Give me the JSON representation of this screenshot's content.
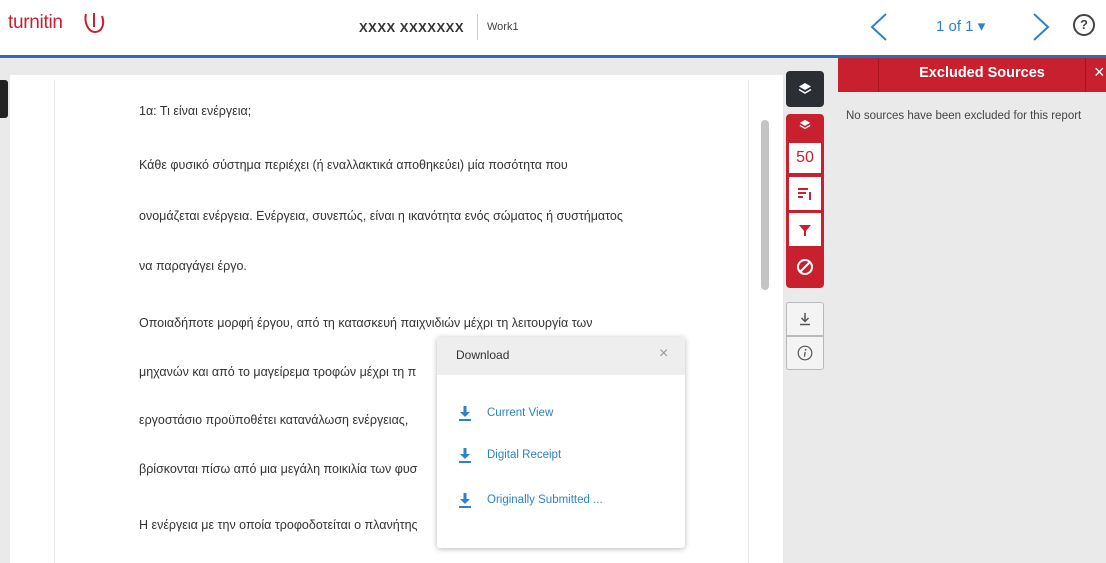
{
  "header": {
    "logo_text": "turnitin",
    "author": "XXXX XXXXXXX",
    "work_title": "Work1",
    "page_indicator": "1 of 1 ▾",
    "help_label": "?"
  },
  "document": {
    "lines": [
      "1α: Τι είναι ενέργεια;",
      "Κάθε φυσικό σύστημα περιέχει (ή εναλλακτικά αποθηκεύει) μία ποσότητα που",
      "ονομάζεται ενέργεια. Ενέργεια, συνεπώς, είναι η ικανότητα ενός σώματος ή συστήματος",
      "να παραγάγει έργο.",
      "Οποιαδήποτε μορφή έργου, από τη κατασκευή παιχνιδιών μέχρι τη λειτουργία των",
      "μηχανών και από το μαγείρεμα τροφών μέχρι τη π",
      "εργοστάσιο προϋποθέτει κατανάλωση ενέργειας,",
      "βρίσκονται πίσω από μια μεγάλη ποικιλία των φυσ",
      "Η ενέργεια με την οποία τροφοδοτείται ο πλανήτης"
    ]
  },
  "toolbar": {
    "similarity_score": "50"
  },
  "panel": {
    "title": "Excluded Sources",
    "close_label": "×",
    "empty_message": "No sources have been excluded for this report"
  },
  "modal": {
    "title": "Download",
    "close_label": "×",
    "items": [
      {
        "label": "Current View"
      },
      {
        "label": "Digital Receipt"
      },
      {
        "label": "Originally Submitted ..."
      }
    ]
  },
  "colors": {
    "brand_red": "#c8202f",
    "link_blue": "#2d82c9",
    "header_rule": "#2a6db0",
    "toolbar_dark": "#2b2f33"
  }
}
